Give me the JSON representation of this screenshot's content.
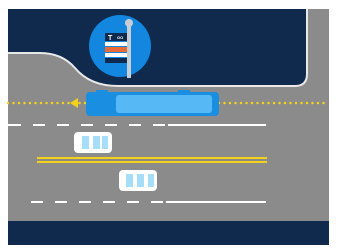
{
  "scene": {
    "title": "",
    "colors": {
      "background": "#ffffff",
      "sidewalk_frame": "#0f2a4d",
      "road": "#8b8b8b",
      "curb": "#e9e9e9",
      "lane_dash": "#ffffff",
      "guide_dots": "#f2d21a",
      "center_line": "#f2d21a",
      "bus_body": "#1a8fe2",
      "bus_window": "#56b9f6",
      "stop_badge": "#1387df",
      "stop_pole": "#c8ced6",
      "car_body": "#ffffff",
      "car_window": "#a6ddf8"
    },
    "bus_stop_sign": {
      "icon": "bus-stop-sign-icon",
      "letter": "T",
      "small_text": "GO"
    },
    "bus": {
      "icon": "bus-icon",
      "direction": "left"
    },
    "cars": [
      {
        "icon": "car-icon"
      },
      {
        "icon": "car-icon"
      }
    ]
  }
}
